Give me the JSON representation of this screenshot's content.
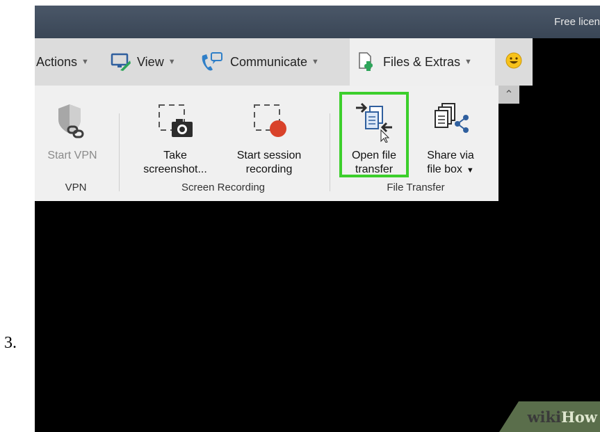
{
  "step": {
    "number": "3."
  },
  "titlebar": {
    "license_text": "Free licen"
  },
  "tabs": [
    {
      "label": "Actions"
    },
    {
      "label": "View"
    },
    {
      "label": "Communicate"
    },
    {
      "label": "Files & Extras"
    }
  ],
  "ribbon": {
    "buttons": {
      "start_vpn": "Start VPN",
      "take_screenshot_1": "Take",
      "take_screenshot_2": "screenshot...",
      "start_recording_1": "Start session",
      "start_recording_2": "recording",
      "open_transfer_1": "Open file",
      "open_transfer_2": "transfer",
      "share_1": "Share via",
      "share_2": "file box"
    },
    "groups": {
      "vpn": "VPN",
      "screen_recording": "Screen Recording",
      "file_transfer": "File Transfer"
    }
  },
  "watermark": {
    "wiki": "wiki",
    "how": "How"
  },
  "colors": {
    "highlight": "#3ccf2c",
    "accent_green": "#2ea55a",
    "record_red": "#d9422a",
    "phone_blue": "#2f7fc8"
  },
  "icons": [
    "monitor-icon",
    "phone-chat-icon",
    "file-puzzle-icon",
    "smiley-icon",
    "shield-link-icon",
    "camera-icon",
    "record-icon",
    "file-transfer-icon",
    "share-files-icon"
  ]
}
